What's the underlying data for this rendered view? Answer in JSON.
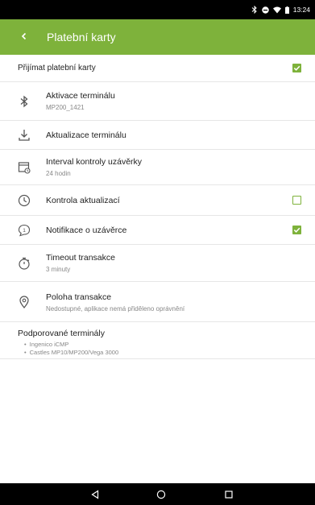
{
  "status_bar": {
    "time": "13:24",
    "icons": [
      "bluetooth-icon",
      "do-not-disturb-icon",
      "wifi-icon",
      "battery-icon"
    ]
  },
  "app_bar": {
    "title": "Platební karty",
    "back_icon": "chevron-left-icon",
    "background": "#7eb23b"
  },
  "rows": {
    "accept_cards": {
      "label": "Přijímat platební karty",
      "checked": true
    },
    "terminal_activation": {
      "icon": "bluetooth-icon",
      "title": "Aktivace terminálu",
      "subtitle": "MP200_1421"
    },
    "terminal_update": {
      "icon": "download-icon",
      "title": "Aktualizace terminálu"
    },
    "closure_interval": {
      "icon": "calendar-clock-icon",
      "title": "Interval kontroly uzávěrky",
      "subtitle": "24 hodin"
    },
    "update_check": {
      "icon": "clock-icon",
      "title": "Kontrola aktualizací",
      "checked": false
    },
    "closure_notification": {
      "icon": "notification-icon",
      "title": "Notifikace o uzávěrce",
      "checked": true
    },
    "transaction_timeout": {
      "icon": "timer-icon",
      "title": "Timeout transakce",
      "subtitle": "3 minuty"
    },
    "transaction_location": {
      "icon": "location-pin-icon",
      "title": "Poloha transakce",
      "subtitle": "Nedostupné, aplikace nemá přiděleno oprávnění"
    }
  },
  "supported_terminals": {
    "title": "Podporované terminály",
    "items": [
      "Ingenico iCMP",
      "Castles MP10/MP200/Vega 3000"
    ]
  },
  "nav_bar": {
    "buttons": [
      "back-triangle-icon",
      "home-circle-icon",
      "recents-square-icon"
    ]
  },
  "colors": {
    "accent": "#7eb23b",
    "divider": "#e6e6e6",
    "subtitle": "#888888"
  }
}
